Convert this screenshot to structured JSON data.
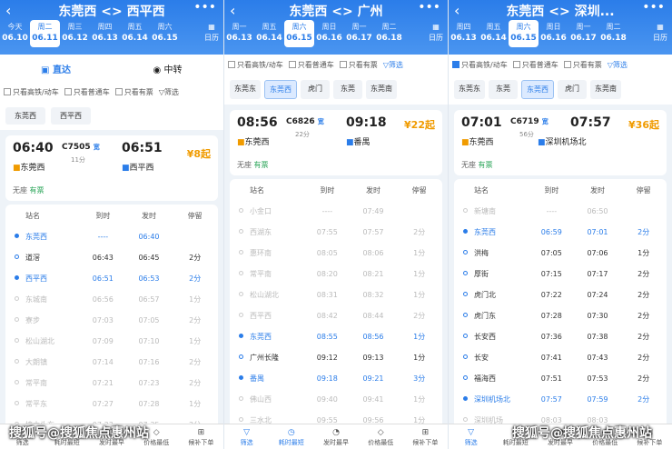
{
  "panels": [
    {
      "title": "东莞西 <> 西平西",
      "dates": [
        {
          "w": "今天",
          "d": "06.10"
        },
        {
          "w": "周二",
          "d": "06.11"
        },
        {
          "w": "周三",
          "d": "06.12"
        },
        {
          "w": "周四",
          "d": "06.13"
        },
        {
          "w": "周五",
          "d": "06.14"
        },
        {
          "w": "周六",
          "d": "06.15"
        }
      ],
      "calendar": "日历",
      "tab_a": "直达",
      "tab_b": "中转",
      "filters": [
        "只看高铁/动车",
        "只看普通车",
        "只看有票",
        "筛选"
      ],
      "stations": [
        "东莞西",
        "西平西"
      ],
      "dep": "06:40",
      "train": "C7505",
      "badge": "宽",
      "dur": "11分",
      "arr": "06:51",
      "from": "东莞西",
      "to": "西平西",
      "price": "¥8起",
      "seat_label": "无座",
      "seat_val": "有票",
      "head": [
        "站名",
        "到时",
        "发时",
        "停留"
      ],
      "rows": [
        [
          "东莞西",
          "----",
          "06:40",
          ""
        ],
        [
          "道滘",
          "06:43",
          "06:45",
          "2分"
        ],
        [
          "西平西",
          "06:51",
          "06:53",
          "2分"
        ],
        [
          "东城南",
          "06:56",
          "06:57",
          "1分"
        ],
        [
          "寮步",
          "07:03",
          "07:05",
          "2分"
        ],
        [
          "松山湖北",
          "07:09",
          "07:10",
          "1分"
        ],
        [
          "大朗镇",
          "07:14",
          "07:16",
          "2分"
        ],
        [
          "常平南",
          "07:21",
          "07:23",
          "2分"
        ],
        [
          "常平东",
          "07:27",
          "07:28",
          "1分"
        ],
        [
          "樟木头东",
          "07:33",
          "07:35",
          "2分"
        ]
      ]
    },
    {
      "title": "东莞西 <> 广州",
      "dates": [
        {
          "w": "周一",
          "d": "06.13"
        },
        {
          "w": "周五",
          "d": "06.14"
        },
        {
          "w": "周六",
          "d": "06.15"
        },
        {
          "w": "周日",
          "d": "06.16"
        },
        {
          "w": "周一",
          "d": "06.17"
        },
        {
          "w": "周二",
          "d": "06.18"
        }
      ],
      "calendar": "日历",
      "filters": [
        "只看高铁/动车",
        "只看普通车",
        "只看有票",
        "筛选"
      ],
      "stations": [
        "东莞东",
        "东莞西",
        "虎门",
        "东莞",
        "东莞南"
      ],
      "dep": "08:56",
      "train": "C6826",
      "badge": "宽",
      "dur": "22分",
      "arr": "09:18",
      "from": "东莞西",
      "to": "番禺",
      "price": "¥22起",
      "seat_label": "无座",
      "seat_val": "有票",
      "head": [
        "站名",
        "到时",
        "发时",
        "停留"
      ],
      "rows": [
        [
          "小金口",
          "----",
          "07:49",
          ""
        ],
        [
          "西湖东",
          "07:55",
          "07:57",
          "2分"
        ],
        [
          "惠环南",
          "08:05",
          "08:06",
          "1分"
        ],
        [
          "常平南",
          "08:20",
          "08:21",
          "1分"
        ],
        [
          "松山湖北",
          "08:31",
          "08:32",
          "1分"
        ],
        [
          "西平西",
          "08:42",
          "08:44",
          "2分"
        ],
        [
          "东莞西",
          "08:55",
          "08:56",
          "1分"
        ],
        [
          "广州长隆",
          "09:12",
          "09:13",
          "1分"
        ],
        [
          "番禺",
          "09:18",
          "09:21",
          "3分"
        ],
        [
          "佛山西",
          "09:40",
          "09:41",
          "1分"
        ],
        [
          "三水北",
          "09:55",
          "09:56",
          "1分"
        ]
      ],
      "bottom": [
        "筛选",
        "耗时最短",
        "发时最早",
        "价格最低",
        "候补下单"
      ]
    },
    {
      "title": "东莞西 <> 深圳...",
      "dates": [
        {
          "w": "周四",
          "d": "06.13"
        },
        {
          "w": "周五",
          "d": "06.14"
        },
        {
          "w": "周六",
          "d": "06.15"
        },
        {
          "w": "周日",
          "d": "06.16"
        },
        {
          "w": "周一",
          "d": "06.17"
        },
        {
          "w": "周二",
          "d": "06.18"
        }
      ],
      "calendar": "日历",
      "filters": [
        "只看高铁/动车",
        "只看普通车",
        "只看有票",
        "筛选"
      ],
      "stations": [
        "东莞东",
        "东莞",
        "东莞西",
        "虎门",
        "东莞南"
      ],
      "dep": "07:01",
      "train": "C6719",
      "badge": "宽",
      "dur": "56分",
      "arr": "07:57",
      "from": "东莞西",
      "to": "深圳机场北",
      "price": "¥36起",
      "seat_label": "无座",
      "seat_val": "有票",
      "head": [
        "站名",
        "到时",
        "发时",
        "停留"
      ],
      "rows": [
        [
          "新塘南",
          "----",
          "06:50",
          ""
        ],
        [
          "东莞西",
          "06:59",
          "07:01",
          "2分"
        ],
        [
          "洪梅",
          "07:05",
          "07:06",
          "1分"
        ],
        [
          "厚街",
          "07:15",
          "07:17",
          "2分"
        ],
        [
          "虎门北",
          "07:22",
          "07:24",
          "2分"
        ],
        [
          "虎门东",
          "07:28",
          "07:30",
          "2分"
        ],
        [
          "长安西",
          "07:36",
          "07:38",
          "2分"
        ],
        [
          "长安",
          "07:41",
          "07:43",
          "2分"
        ],
        [
          "福海西",
          "07:51",
          "07:53",
          "2分"
        ],
        [
          "深圳机场北",
          "07:57",
          "07:59",
          "2分"
        ],
        [
          "深圳机场",
          "08:03",
          "08:03",
          ""
        ]
      ],
      "bottom": [
        "筛选",
        "耗时最短",
        "发时最早",
        "价格最低",
        "候补下单"
      ]
    }
  ],
  "bottom_a": [
    "筛选",
    "耗时最短",
    "发时最早",
    "价格最低",
    "候补下单"
  ],
  "watermark": "搜狐号@搜狐焦点惠州站"
}
